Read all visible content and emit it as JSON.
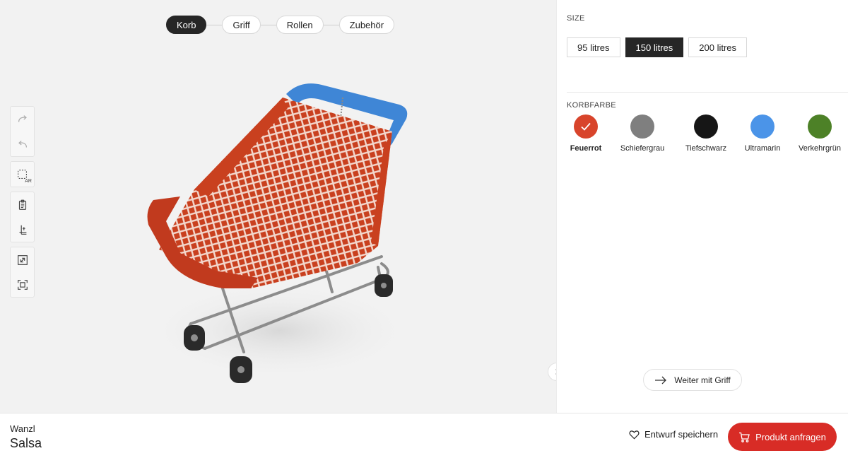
{
  "steps": [
    {
      "label": "Korb",
      "active": true
    },
    {
      "label": "Griff",
      "active": false
    },
    {
      "label": "Rollen",
      "active": false
    },
    {
      "label": "Zubehör",
      "active": false
    }
  ],
  "toolbar": {
    "redo_icon": "redo-icon",
    "undo_icon": "undo-icon",
    "ar_label": "AR",
    "icons": [
      "redo-icon",
      "undo-icon",
      "ar-view-icon",
      "clipboard-icon",
      "dimensions-icon",
      "fullscreen-icon",
      "focus-frame-icon"
    ]
  },
  "config": {
    "size_title": "SIZE",
    "sizes": [
      {
        "label": "95 litres",
        "selected": false
      },
      {
        "label": "150 litres",
        "selected": true
      },
      {
        "label": "200 litres",
        "selected": false
      }
    ],
    "color_title": "KORBFARBE",
    "colors": [
      {
        "label": "Feuerrot",
        "hex": "#d8442b",
        "selected": true
      },
      {
        "label": "Schiefergrau",
        "hex": "#7f7f7f",
        "selected": false
      },
      {
        "label": "Tiefschwarz",
        "hex": "#161616",
        "selected": false
      },
      {
        "label": "Ultramarin",
        "hex": "#4b94e8",
        "selected": false
      },
      {
        "label": "Verkehrgrün",
        "hex": "#4d8127",
        "selected": false
      }
    ],
    "next_label": "Weiter mit Griff"
  },
  "footer": {
    "brand": "Wanzl",
    "product": "Salsa",
    "save_label": "Entwurf speichern",
    "request_label": "Produkt anfragen",
    "accent_color": "#d82c26"
  }
}
